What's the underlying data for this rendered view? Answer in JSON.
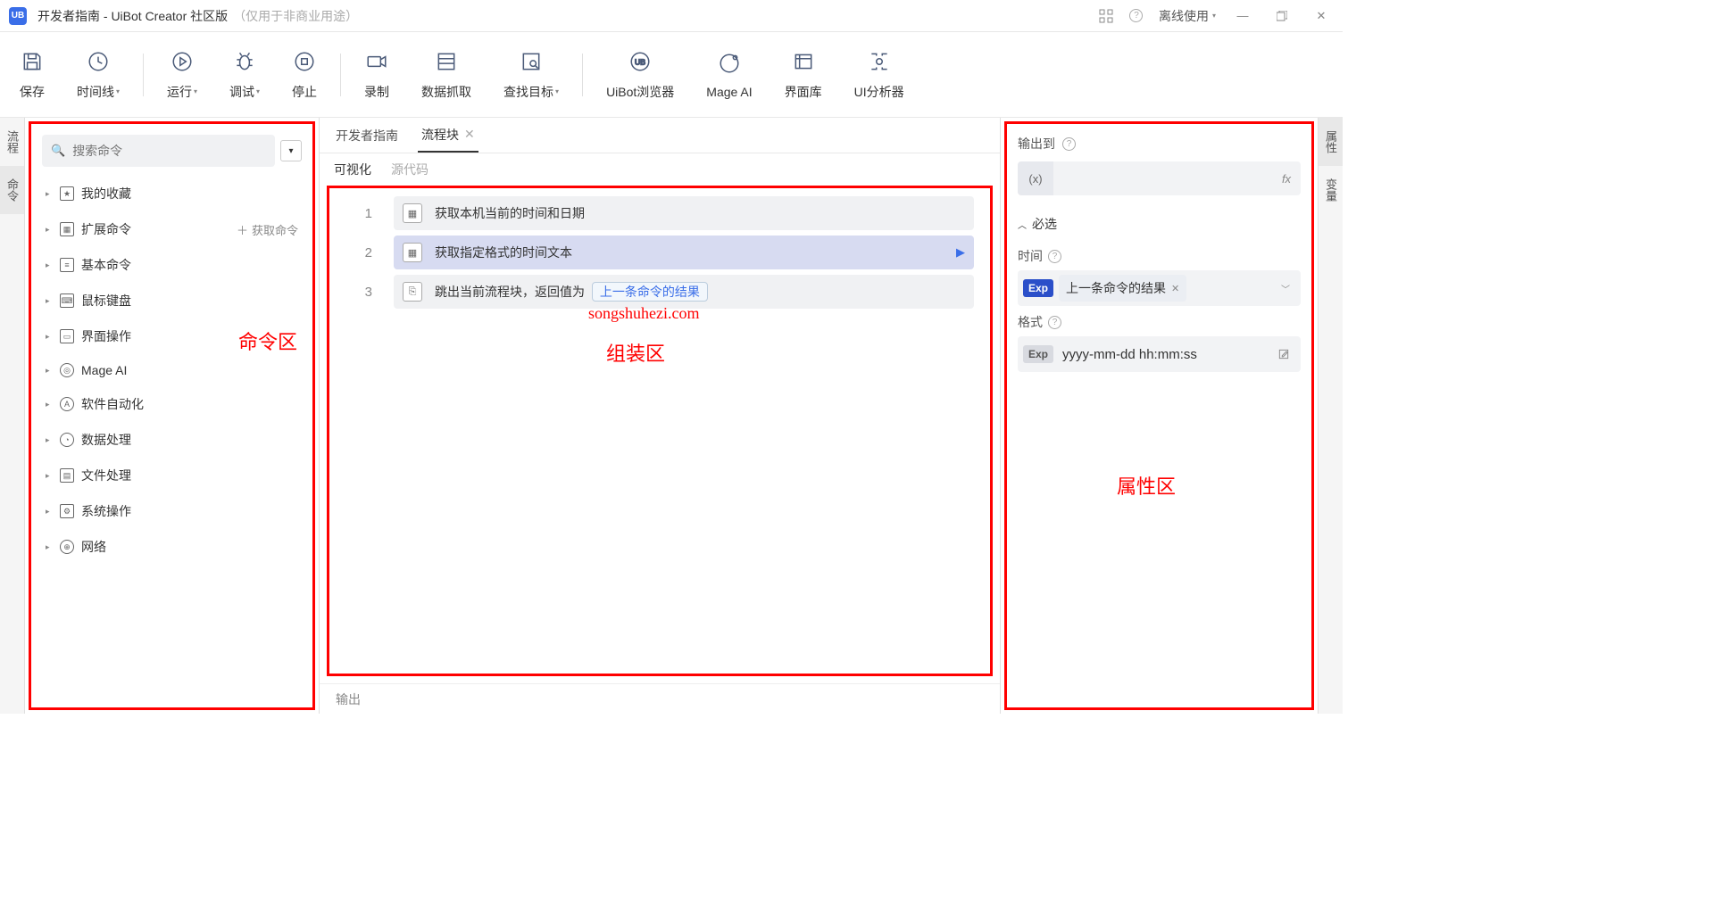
{
  "titlebar": {
    "title": "开发者指南 - UiBot Creator 社区版",
    "subtitle": "（仅用于非商业用途）",
    "offline": "离线使用"
  },
  "toolbar": {
    "save": "保存",
    "timeline": "时间线",
    "run": "运行",
    "debug": "调试",
    "stop": "停止",
    "record": "录制",
    "scrape": "数据抓取",
    "find_target": "查找目标",
    "browser": "UiBot浏览器",
    "mage": "Mage AI",
    "uilib": "界面库",
    "analyzer": "UI分析器"
  },
  "left_tabs": {
    "flow": "流程",
    "cmd": "命令"
  },
  "right_tabs": {
    "attr": "属性",
    "var": "变量"
  },
  "sidebar": {
    "search_placeholder": "搜索命令",
    "items": {
      "fav": "我的收藏",
      "ext": "扩展命令",
      "get_cmd": "获取命令",
      "basic": "基本命令",
      "mouse": "鼠标键盘",
      "ui": "界面操作",
      "mage": "Mage AI",
      "soft": "软件自动化",
      "data": "数据处理",
      "file": "文件处理",
      "sys": "系统操作",
      "net": "网络"
    }
  },
  "tabs": {
    "guide": "开发者指南",
    "block": "流程块"
  },
  "viewtabs": {
    "visual": "可视化",
    "source": "源代码"
  },
  "rows": {
    "r1": {
      "ln": "1",
      "text": "获取本机当前的时间和日期"
    },
    "r2": {
      "ln": "2",
      "text": "获取指定格式的时间文本"
    },
    "r3": {
      "ln": "3",
      "text_a": "跳出当前流程块，返回值为",
      "chip": "上一条命令的结果"
    }
  },
  "props": {
    "output_to": "输出到",
    "required": "必选",
    "time_label": "时间",
    "time_value": "上一条命令的结果",
    "format_label": "格式",
    "format_value": "yyyy-mm-dd hh:mm:ss",
    "exp": "Exp"
  },
  "output_label": "输出",
  "annotations": {
    "cmd_area": "命令区",
    "assembly_area": "组装区",
    "prop_area": "属性区",
    "watermark": "songshuhezi.com"
  }
}
